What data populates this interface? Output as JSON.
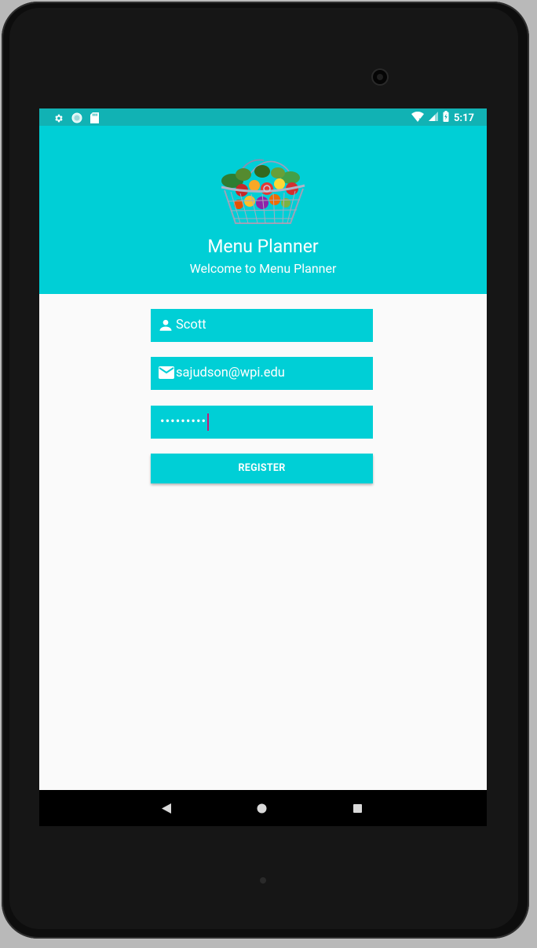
{
  "status_bar": {
    "time": "5:17",
    "left_icons": [
      "gear-icon",
      "sync-circle-icon",
      "sd-card-icon"
    ],
    "right_icons": [
      "wifi-icon",
      "signal-icon",
      "battery-charging-icon"
    ]
  },
  "header": {
    "logo_icon": "vegetable-basket-icon",
    "title": "Menu Planner",
    "subtitle": "Welcome to Menu Planner",
    "background_color": "#00cfd6"
  },
  "form": {
    "name_icon": "person-icon",
    "name_value": "Scott",
    "email_icon": "email-icon",
    "email_value": "sajudson@wpi.edu",
    "password_masked": "•••••••••",
    "register_label": "REGISTER"
  },
  "nav_bar": {
    "back_icon": "back-triangle-icon",
    "home_icon": "home-circle-icon",
    "recents_icon": "recents-square-icon"
  }
}
